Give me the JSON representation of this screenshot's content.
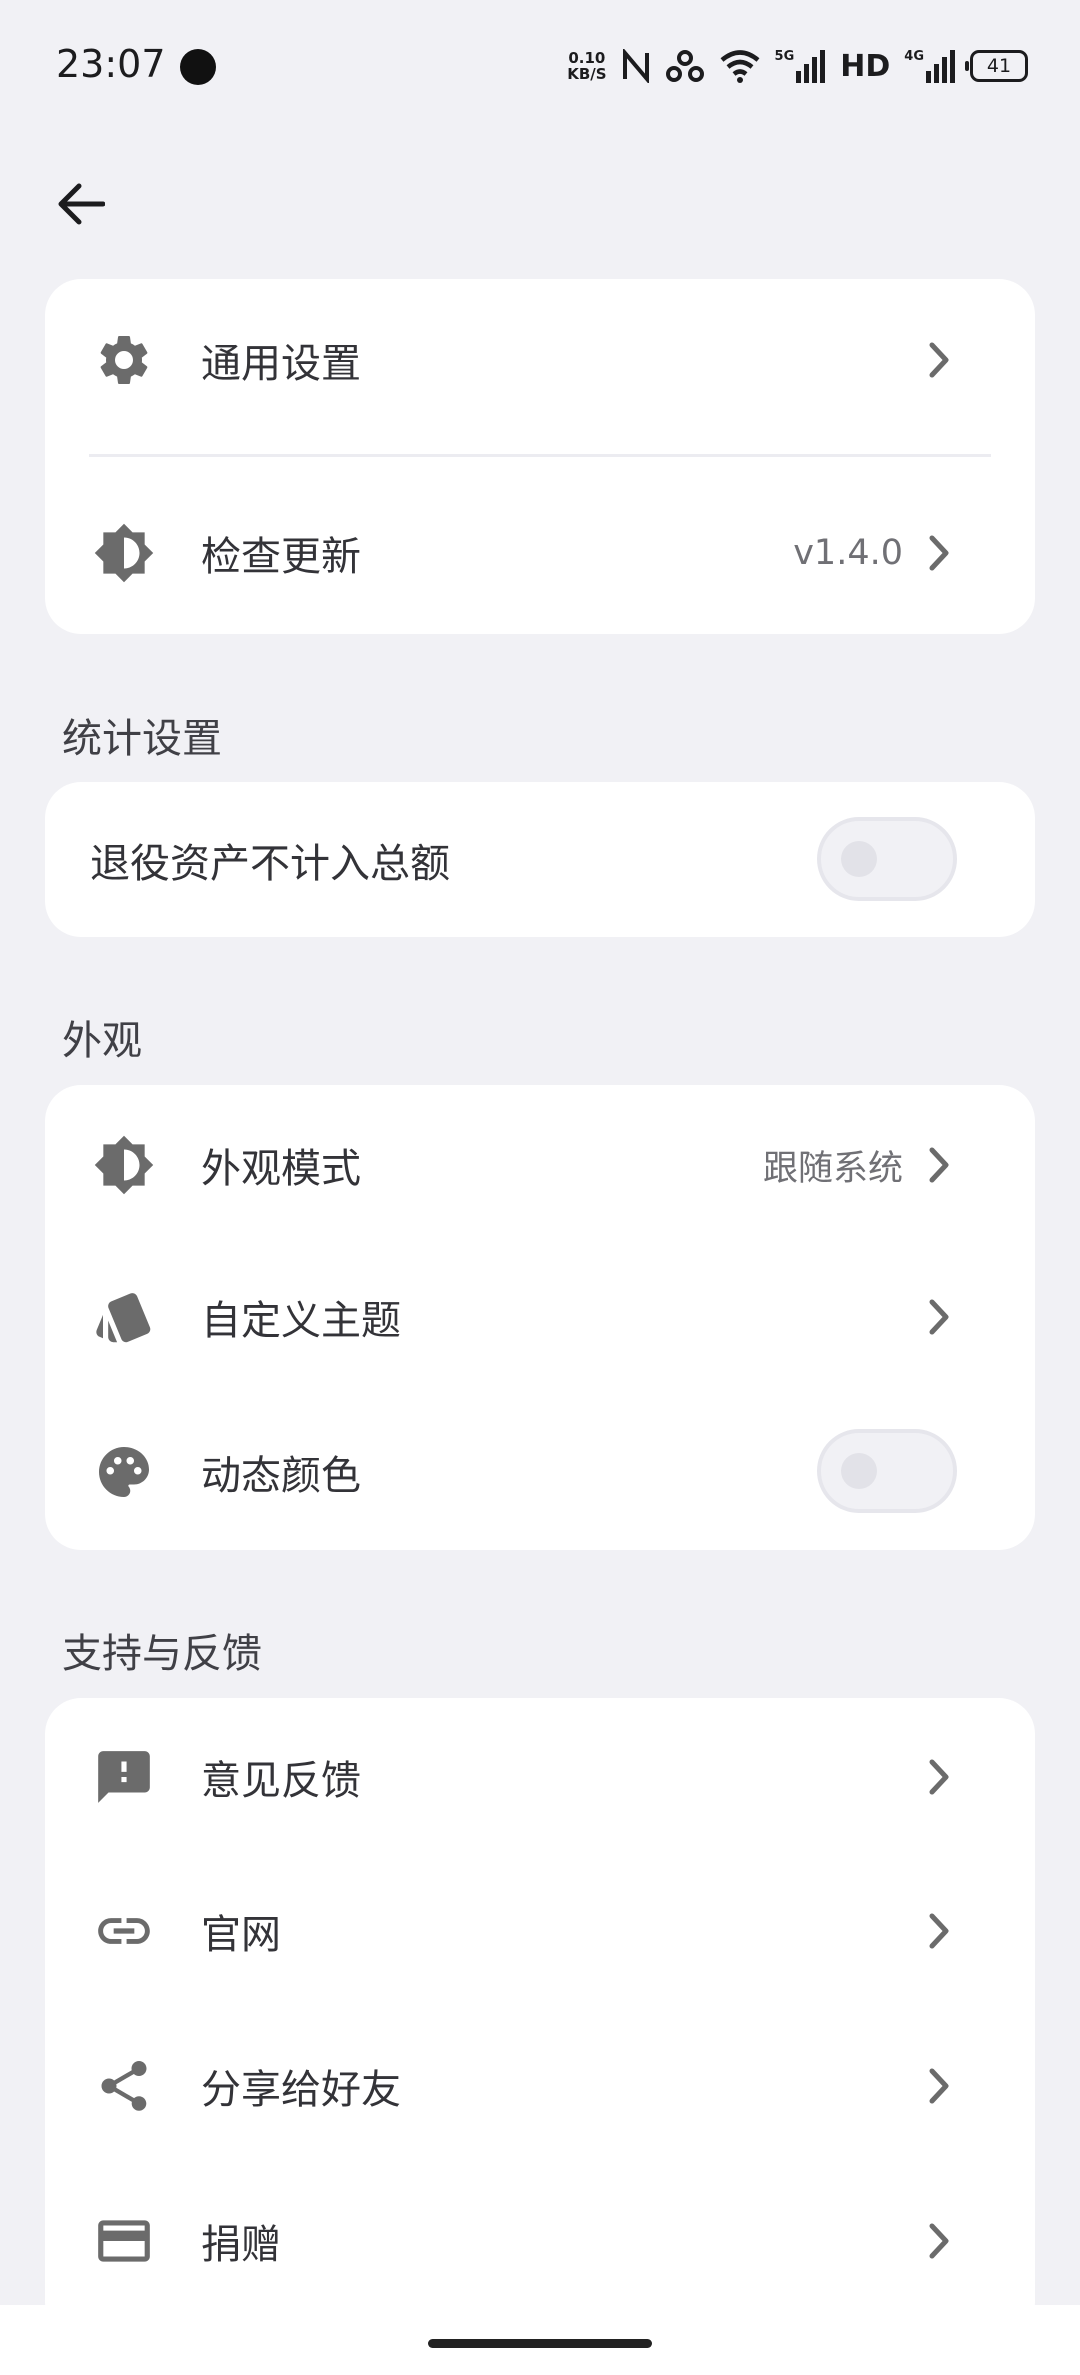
{
  "status_bar": {
    "time": "23:07",
    "net_speed_top": "0.10",
    "net_speed_bottom": "KB/S",
    "signal_1_label": "5G",
    "hd_label": "HD",
    "signal_2_label": "4G",
    "battery": "41"
  },
  "top_card": {
    "general_settings": {
      "label": "通用设置",
      "icon": "gear-icon"
    },
    "check_update": {
      "label": "检查更新",
      "value": "v1.4.0",
      "icon": "brightness-icon"
    }
  },
  "stats": {
    "title": "统计设置",
    "retired_assets": {
      "label": "退役资产不计入总额",
      "enabled": false
    }
  },
  "appearance": {
    "title": "外观",
    "mode": {
      "label": "外观模式",
      "value": "跟随系统",
      "icon": "brightness-icon"
    },
    "custom_theme": {
      "label": "自定义主题",
      "icon": "swatch-icon"
    },
    "dynamic_color": {
      "label": "动态颜色",
      "icon": "palette-icon",
      "enabled": false
    }
  },
  "support": {
    "title": "支持与反馈",
    "feedback": {
      "label": "意见反馈",
      "icon": "feedback-icon"
    },
    "website": {
      "label": "官网",
      "icon": "link-icon"
    },
    "share": {
      "label": "分享给好友",
      "icon": "share-icon"
    },
    "donate": {
      "label": "捐赠",
      "icon": "credit-card-icon"
    }
  },
  "colors": {
    "background": "#f1f1f5",
    "card": "#ffffff",
    "icon": "#6b6b6b",
    "text": "#333338",
    "secondary_text": "#707075"
  }
}
